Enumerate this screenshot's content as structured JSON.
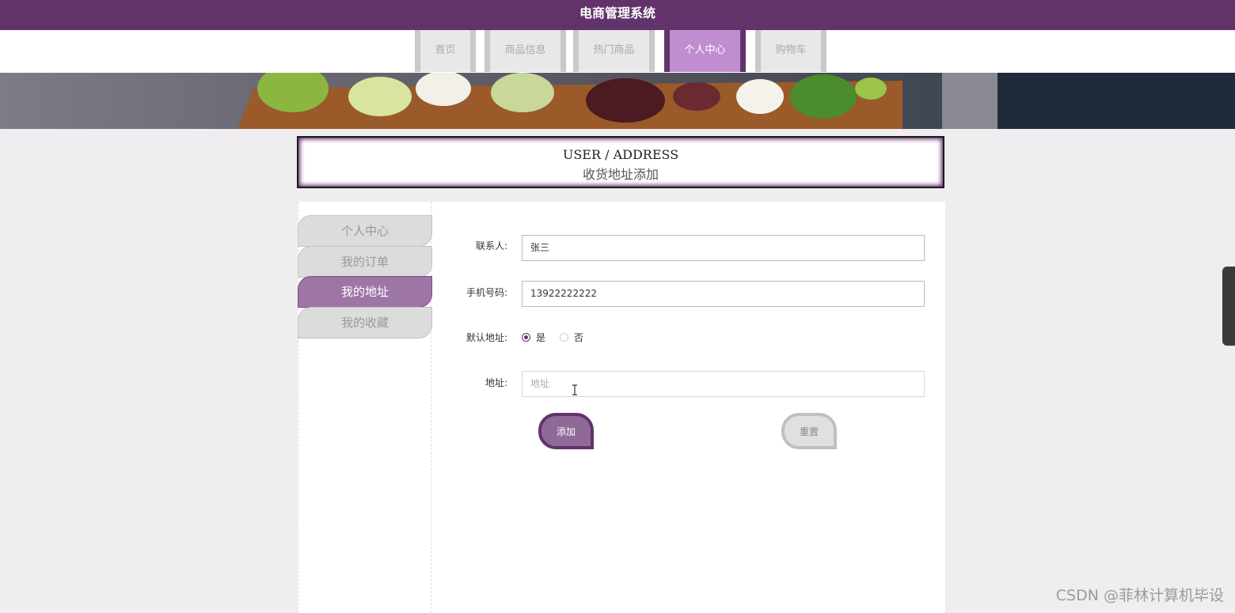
{
  "app": {
    "title": "电商管理系统"
  },
  "nav": {
    "items": [
      {
        "label": "首页"
      },
      {
        "label": "商品信息"
      },
      {
        "label": "热门商品"
      },
      {
        "label": "个人中心"
      },
      {
        "label": "购物车"
      }
    ],
    "active": "个人中心"
  },
  "header": {
    "title_en": "USER / ADDRESS",
    "title_cn": "收货地址添加"
  },
  "sidebar": {
    "items": [
      {
        "label": "个人中心"
      },
      {
        "label": "我的订单"
      },
      {
        "label": "我的地址"
      },
      {
        "label": "我的收藏"
      }
    ],
    "active": "我的地址"
  },
  "form": {
    "contact_label": "联系人:",
    "contact_value": "张三",
    "phone_label": "手机号码:",
    "phone_value": "13922222222",
    "default_label": "默认地址:",
    "default_yes": "是",
    "default_no": "否",
    "default_selected": "是",
    "address_label": "地址:",
    "address_placeholder": "地址",
    "add_button": "添加",
    "reset_button": "重置"
  },
  "watermark": "CSDN @菲林计算机毕设",
  "colors": {
    "brand": "#62336b",
    "nav_active": "#c08ed0",
    "sidebar_active": "#9e76a6"
  }
}
